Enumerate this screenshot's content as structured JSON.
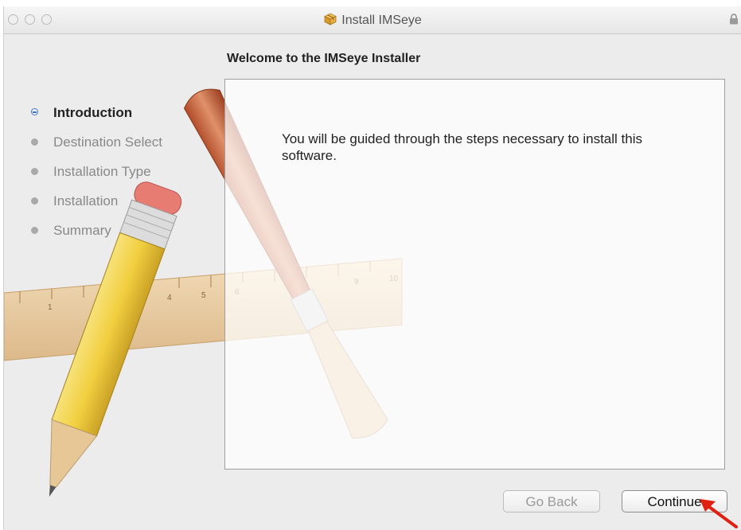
{
  "window": {
    "title": "Install IMSeye",
    "icon": "package-icon",
    "lock_icon": "lock-icon"
  },
  "header": {
    "welcome": "Welcome to the IMSeye Installer"
  },
  "sidebar": {
    "steps": [
      {
        "label": "Introduction",
        "active": true
      },
      {
        "label": "Destination Select",
        "active": false
      },
      {
        "label": "Installation Type",
        "active": false
      },
      {
        "label": "Installation",
        "active": false
      },
      {
        "label": "Summary",
        "active": false
      }
    ]
  },
  "content": {
    "message": "You will be guided through the steps necessary to install this software."
  },
  "buttons": {
    "go_back": "Go Back",
    "continue": "Continue"
  },
  "annotation": {
    "arrow_color": "#e02010"
  }
}
